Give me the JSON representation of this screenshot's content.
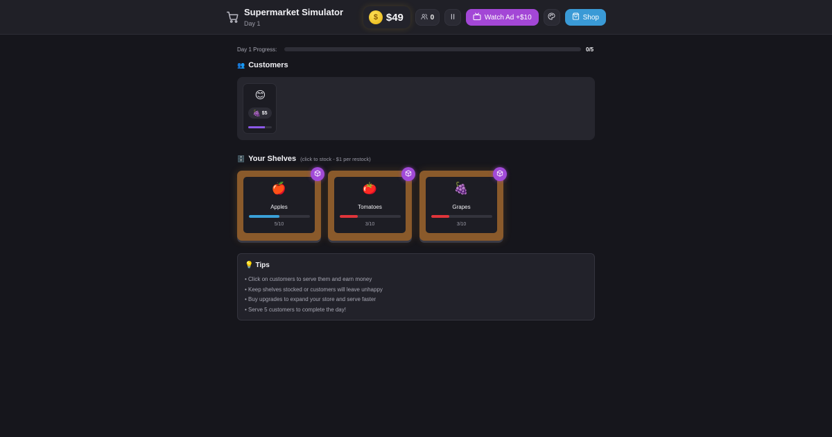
{
  "header": {
    "title": "Supermarket Simulator",
    "day": "Day 1",
    "money": "$49",
    "coin_symbol": "$",
    "customers_served": "0",
    "watch_ad_label": "Watch Ad +$10",
    "shop_label": "Shop",
    "icons": [
      "cart-icon",
      "coin-icon",
      "users-icon",
      "pause-icon",
      "tv-icon",
      "palette-icon",
      "shopping-bag-icon"
    ]
  },
  "progress": {
    "label": "Day 1 Progress:",
    "count": "0/5",
    "fraction": 0
  },
  "customers": {
    "title": "Customers",
    "title_emoji": "👥",
    "list": [
      {
        "face": "😊",
        "order_item": "🍇",
        "order_price": "$5",
        "patience": 0.72
      }
    ]
  },
  "shelves": {
    "title": "Your Shelves",
    "title_emoji": "🗄️",
    "hint": "(click to stock - $1 per restock)",
    "items": [
      {
        "emoji": "🍎",
        "name": "Apples",
        "stock": 5,
        "capacity": 10,
        "count_label": "5/10",
        "color": "#3aa0d8"
      },
      {
        "emoji": "🍅",
        "name": "Tomatoes",
        "stock": 3,
        "capacity": 10,
        "count_label": "3/10",
        "color": "#e0343a"
      },
      {
        "emoji": "🍇",
        "name": "Grapes",
        "stock": 3,
        "capacity": 10,
        "count_label": "3/10",
        "color": "#e0343a"
      }
    ]
  },
  "tips": {
    "title": "Tips",
    "title_emoji": "💡",
    "items": [
      "• Click on customers to serve them and earn money",
      "• Keep shelves stocked or customers will leave unhappy",
      "• Buy upgrades to expand your store and serve faster",
      "• Serve 5 customers to complete the day!"
    ]
  },
  "colors": {
    "background": "#16161c",
    "header": "#202027",
    "accent_purple": "#a347d6",
    "accent_blue": "#3a9ad6",
    "shelf_wood": "#8a5a2b",
    "coin_gold": "#f0c020"
  }
}
